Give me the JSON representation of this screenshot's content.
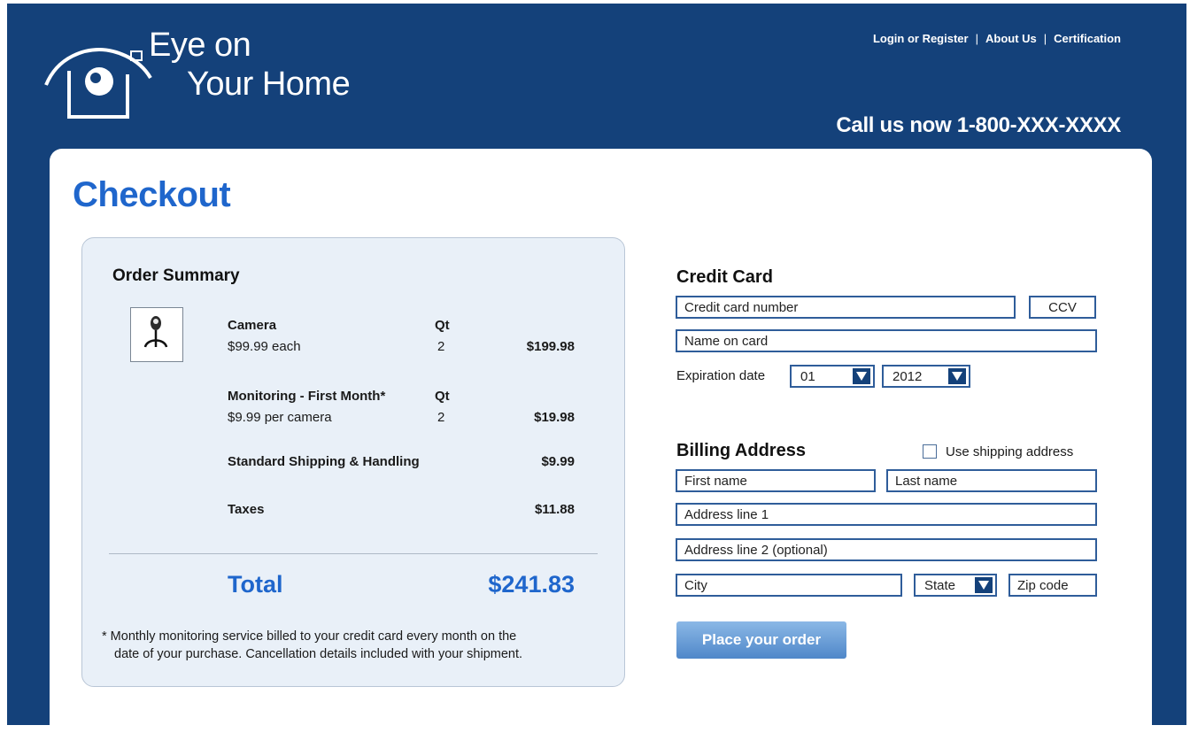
{
  "header": {
    "logo_line1": "Eye on",
    "logo_line2": "Your Home",
    "nav": [
      "Login or Register",
      "About Us",
      "Certification"
    ],
    "nav_separator": "|",
    "call": "Call us now 1-800-XXX-XXXX"
  },
  "page_title": "Checkout",
  "order_summary": {
    "title": "Order Summary",
    "thumb_icon": "webcam-icon",
    "camera": {
      "name": "Camera",
      "qt_label": "Qt",
      "unit": "$99.99 each",
      "qty": "2",
      "price": "$199.98"
    },
    "monitoring": {
      "name": "Monitoring - First Month*",
      "qt_label": "Qt",
      "unit": "$9.99 per camera",
      "qty": "2",
      "price": "$19.98"
    },
    "shipping": {
      "name": "Standard Shipping & Handling",
      "price": "$9.99"
    },
    "taxes": {
      "name": "Taxes",
      "price": "$11.88"
    },
    "total_label": "Total",
    "total_value": "$241.83",
    "footnote_line1": "* Monthly monitoring service billed to your credit card every month on the",
    "footnote_line2": "date of your purchase. Cancellation details included with your shipment."
  },
  "credit_card": {
    "title": "Credit Card",
    "number_placeholder": "Credit card number",
    "ccv_placeholder": "CCV",
    "name_placeholder": "Name on card",
    "expiration_label": "Expiration date",
    "exp_month": "01",
    "exp_year": "2012"
  },
  "billing": {
    "title": "Billing Address",
    "use_shipping_label": "Use shipping address",
    "use_shipping_checked": false,
    "first_name_placeholder": "First name",
    "last_name_placeholder": "Last name",
    "address1_placeholder": "Address line 1",
    "address2_placeholder": "Address line 2 (optional)",
    "city_placeholder": "City",
    "state_value": "State",
    "zip_placeholder": "Zip code"
  },
  "place_order_label": "Place your order",
  "colors": {
    "header_bg": "#14417a",
    "accent_blue": "#1f66cc",
    "summary_bg": "#e9f0f8",
    "button": "#5a90cf"
  }
}
